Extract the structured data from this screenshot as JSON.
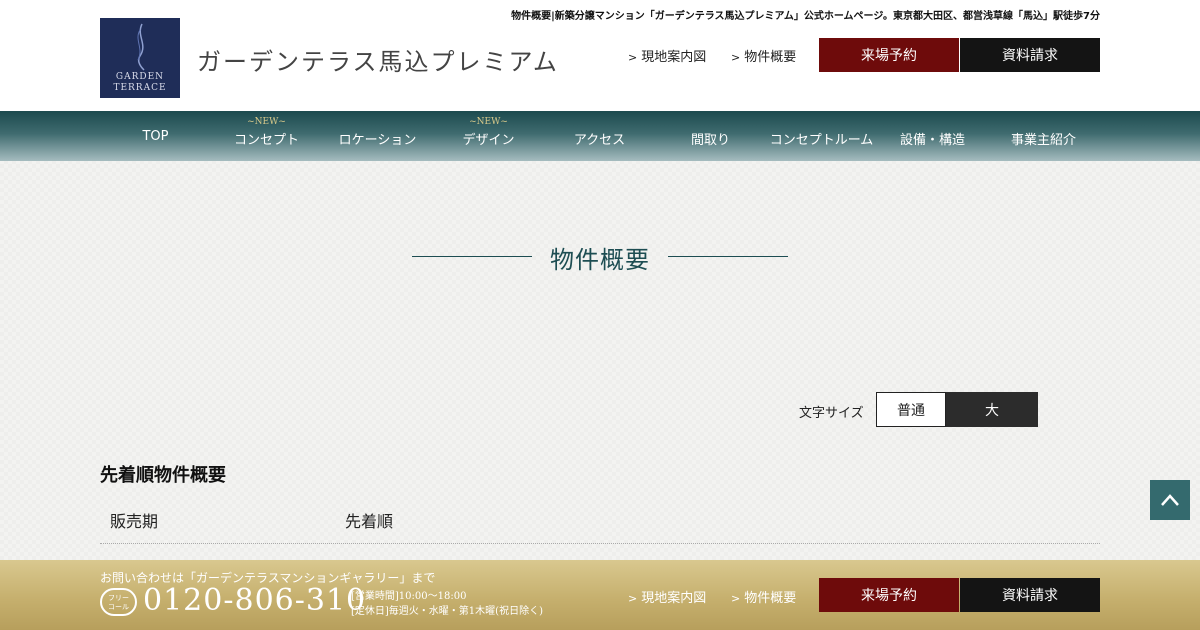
{
  "header": {
    "tagline": "物件概要|新築分譲マンション「ガーデンテラス馬込プレミアム」公式ホームページ。東京都大田区、都営浅草線「馬込」駅徒歩7分",
    "logo_line1": "GARDEN",
    "logo_line2": "TERRACE",
    "site_title": "ガーデンテラス馬込プレミアム",
    "links": [
      "現地案内図",
      "物件概要"
    ],
    "reserve_button": "来場予約",
    "request_button": "資料請求"
  },
  "nav": {
    "new_badge": "~NEW~",
    "items": [
      "TOP",
      "コンセプト",
      "ロケーション",
      "デザイン",
      "アクセス",
      "間取り",
      "コンセプトルーム",
      "設備・構造",
      "事業主紹介"
    ]
  },
  "page": {
    "title": "物件概要",
    "font_size_label": "文字サイズ",
    "font_size_normal": "普通",
    "font_size_large": "大",
    "section_heading": "先着順物件概要",
    "specs": [
      {
        "key": "販売期",
        "value": "先着順"
      }
    ]
  },
  "footer": {
    "contact_note": "お問い合わせは「ガーデンテラスマンションギャラリー」まで",
    "free_call_line1": "フリー",
    "free_call_line2": "コール",
    "phone": "0120-806-310",
    "hours_line1": "[営業時間]10:00〜18:00",
    "hours_line2": "[定休日]毎週火・水曜・第1木曜(祝日除く)",
    "links": [
      "現地案内図",
      "物件概要"
    ],
    "reserve_button": "来場予約",
    "request_button": "資料請求"
  },
  "colors": {
    "nav_dark": "#1c4a4e",
    "title_teal": "#1d4d52",
    "reserve_red": "#6e0b0b",
    "footer_gold": "#c6b06e",
    "logo_navy": "#1f2d58"
  },
  "icons": [
    "chevron-right-icon",
    "arrow-up-icon",
    "free-call-icon",
    "logo-emblem-icon"
  ]
}
